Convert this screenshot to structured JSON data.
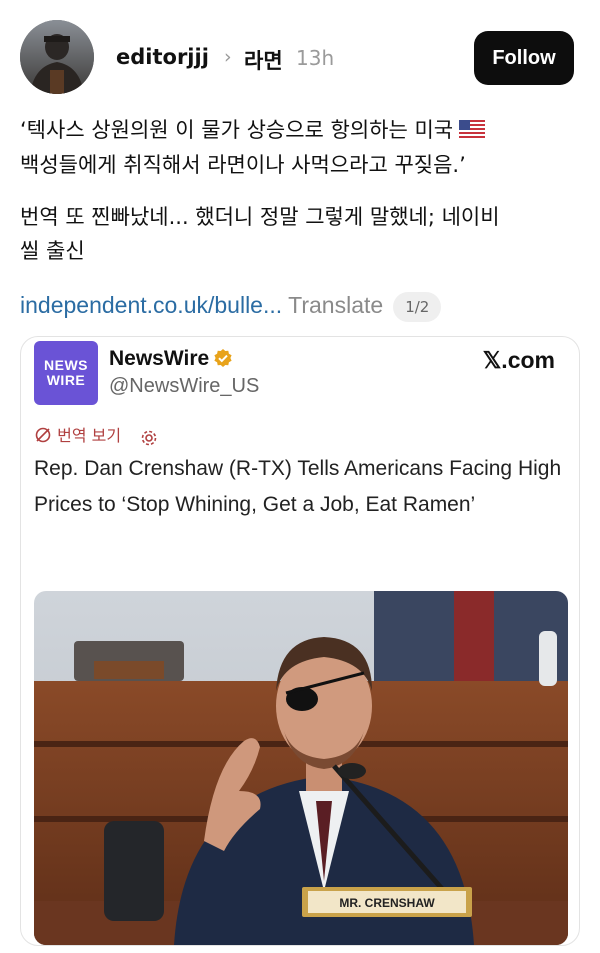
{
  "post": {
    "username": "editorjjj",
    "breadcrumb_separator": "›",
    "topic": "라면",
    "time": "13h",
    "follow_label": "Follow",
    "text_line1": "‘텍사스 상원의원  이 물가 상승으로 항의하는 미국",
    "text_line2": "백성들에게 취직해서 라면이나 사먹으라고 꾸짖음.’",
    "text_line3": "번역 또 찐빠났네... 했더니 정말 그렇게 말했네; 네이비",
    "text_line4": "씰 출신",
    "link_text": "independent.co.uk/bulle...",
    "translate_label": "Translate",
    "pager": "1/2"
  },
  "embed": {
    "logo_line1": "NEWS",
    "logo_line2": "WIRE",
    "name": "NewsWire",
    "handle": "@NewsWire_US",
    "source": "𝕏.com",
    "translate_label": "번역 보기",
    "tweet_text": "Rep. Dan Crenshaw (R-TX) Tells Americans Facing High Prices to ‘Stop Whining, Get a Job, Eat Ramen’",
    "nameplate": "MR. CRENSHAW"
  },
  "colors": {
    "follow_bg": "#0d0d0d",
    "link": "#2b6ca3",
    "logo_bg": "#6a53d6",
    "verified": "#e8a31b",
    "translate_red": "#b04040"
  },
  "icons": [
    "chevron-right-icon",
    "us-flag-icon",
    "verified-badge-icon",
    "translate-icon",
    "gear-icon"
  ]
}
